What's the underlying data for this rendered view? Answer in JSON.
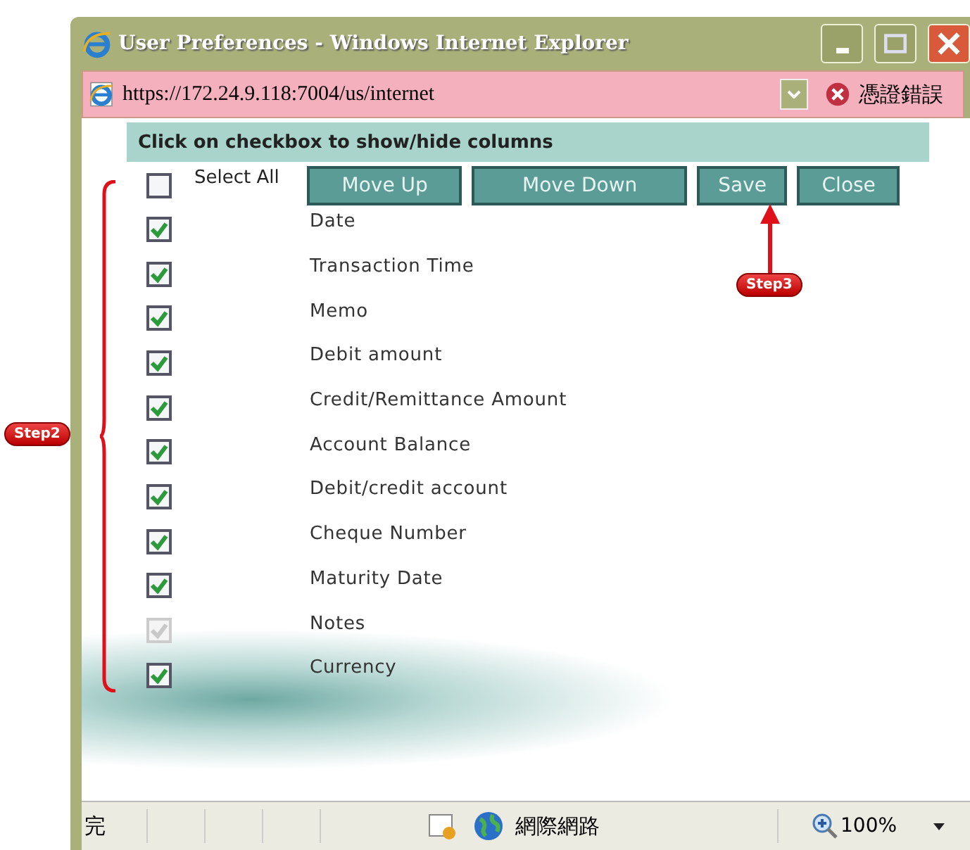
{
  "window": {
    "title": "User Preferences - Windows Internet Explorer"
  },
  "address_bar": {
    "url": "https://172.24.9.118:7004/us/internet",
    "certificate_error": "憑證錯誤"
  },
  "instruction": "Click on checkbox to show/hide columns",
  "select_all": {
    "label": "Select All",
    "checked": false
  },
  "buttons": [
    "Move Up",
    "Move Down",
    "Save",
    "Close"
  ],
  "columns": [
    {
      "label": "Date",
      "checked": true,
      "disabled": false
    },
    {
      "label": "Transaction Time",
      "checked": true,
      "disabled": false
    },
    {
      "label": "Memo",
      "checked": true,
      "disabled": false
    },
    {
      "label": "Debit amount",
      "checked": true,
      "disabled": false
    },
    {
      "label": "Credit/Remittance Amount",
      "checked": true,
      "disabled": false
    },
    {
      "label": "Account Balance",
      "checked": true,
      "disabled": false
    },
    {
      "label": "Debit/credit account",
      "checked": true,
      "disabled": false
    },
    {
      "label": "Cheque Number",
      "checked": true,
      "disabled": false
    },
    {
      "label": "Maturity Date",
      "checked": true,
      "disabled": false
    },
    {
      "label": "Notes",
      "checked": true,
      "disabled": true
    },
    {
      "label": "Currency",
      "checked": true,
      "disabled": false
    }
  ],
  "status_bar": {
    "status": "完",
    "zone": "網際網路",
    "zoom": "100%"
  },
  "callouts": [
    {
      "label": "Step2"
    },
    {
      "label": "Step3"
    }
  ]
}
